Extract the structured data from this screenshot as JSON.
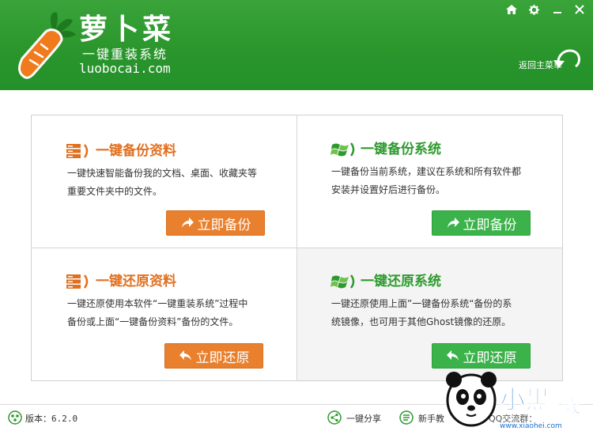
{
  "header": {
    "logo_title": "萝卜菜",
    "logo_subtitle": "一键重装系统",
    "logo_url": "luobocai.com",
    "back_label": "返回主菜单",
    "window_controls": [
      "home-icon",
      "gear-icon",
      "minimize-icon",
      "close-icon"
    ]
  },
  "cards": [
    {
      "title": "一键备份资料",
      "desc_line1": "一键快速智能备份我的文档、桌面、收藏夹等",
      "desc_line2": "重要文件夹中的文件。",
      "button": "立即备份",
      "icon": "backup-data-icon",
      "accent": "#e07020"
    },
    {
      "title": "一键备份系统",
      "desc_line1": "一键备份当前系统，建议在系统和所有软件都",
      "desc_line2": "安装并设置好后进行备份。",
      "button": "立即备份",
      "icon": "windows-logo-icon",
      "accent": "#2d9a2d"
    },
    {
      "title": "一键还原资料",
      "desc_line1": "一键还原使用本软件“一键重装系统”过程中",
      "desc_line2": "备份或上面“一键备份资料”备份的文件。",
      "button": "立即还原",
      "icon": "restore-data-icon",
      "accent": "#e07020"
    },
    {
      "title": "一键还原系统",
      "desc_line1": "一键还原使用上面”一键备份系统“备份的系",
      "desc_line2": "统镜像，也可用于其他Ghost镜像的还原。",
      "button": "立即还原",
      "icon": "windows-logo-icon",
      "accent": "#2d9a2d"
    }
  ],
  "footer": {
    "version": "版本：6.2.0",
    "share": "一键分享",
    "guide": "新手教",
    "qq": "QQ交流群：",
    "watermark_text": "小黑游戏",
    "watermark_url": "www.xiaohei.com"
  },
  "colors": {
    "header_green": "#2a962c",
    "orange_button": "#e8802e",
    "green_button": "#3cb34a"
  }
}
